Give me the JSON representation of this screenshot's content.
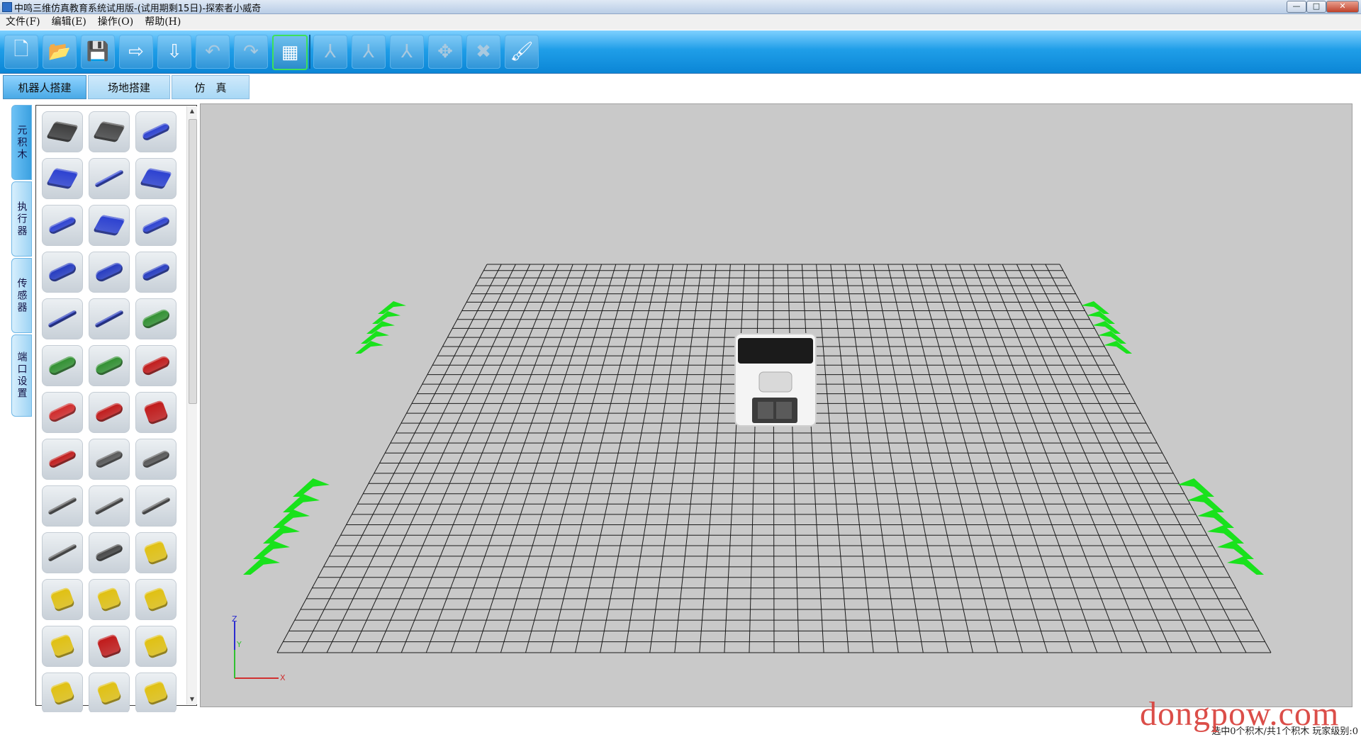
{
  "window": {
    "title": "中鸣三维仿真教育系统试用版-(试用期剩15日)-探索者小威奇",
    "controls": [
      "—",
      "□",
      "✕"
    ]
  },
  "menu": [
    "文件(F)",
    "编辑(E)",
    "操作(O)",
    "帮助(H)"
  ],
  "toolbar": {
    "buttons": [
      {
        "icon": "new-file-icon",
        "glyph": "🗋",
        "state": "normal"
      },
      {
        "icon": "open-folder-icon",
        "glyph": "📂",
        "state": "normal"
      },
      {
        "icon": "save-icon",
        "glyph": "💾",
        "state": "normal"
      },
      {
        "icon": "export-icon",
        "glyph": "⇨",
        "state": "normal"
      },
      {
        "icon": "import-icon",
        "glyph": "⇩",
        "state": "normal"
      },
      {
        "icon": "undo-icon",
        "glyph": "↶",
        "state": "disabled"
      },
      {
        "icon": "redo-icon",
        "glyph": "↷",
        "state": "disabled"
      },
      {
        "icon": "assembly-icon",
        "glyph": "▦",
        "state": "active"
      },
      {
        "icon": "axis-rotate-x-icon",
        "glyph": "⅄",
        "state": "disabled"
      },
      {
        "icon": "axis-rotate-y-icon",
        "glyph": "⅄",
        "state": "disabled"
      },
      {
        "icon": "axis-rotate-z-icon",
        "glyph": "⅄",
        "state": "disabled"
      },
      {
        "icon": "move-icon",
        "glyph": "✥",
        "state": "disabled"
      },
      {
        "icon": "delete-icon",
        "glyph": "✖",
        "state": "disabled"
      },
      {
        "icon": "paint-icon",
        "glyph": "🖌",
        "state": "normal"
      }
    ]
  },
  "tabs": [
    {
      "label": "机器人搭建",
      "active": true
    },
    {
      "label": "场地搭建",
      "active": false
    },
    {
      "label": "仿　真",
      "active": false
    }
  ],
  "side_tabs": [
    {
      "label": "元积木",
      "active": true
    },
    {
      "label": "执行器",
      "active": false
    },
    {
      "label": "传感器",
      "active": false
    },
    {
      "label": "端口设置",
      "active": false
    }
  ],
  "parts": [
    {
      "name": "plate-2x2-dark",
      "color": "#3a3a3a",
      "kind": "plate"
    },
    {
      "name": "plate-2x2-holes-dark",
      "color": "#444444",
      "kind": "plate"
    },
    {
      "name": "beam-blue-short",
      "color": "#2a3fd0",
      "kind": "beam"
    },
    {
      "name": "plate-blue-holes",
      "color": "#2a3fd0",
      "kind": "plate"
    },
    {
      "name": "beam-blue-thin",
      "color": "#2a3fd0",
      "kind": "thin"
    },
    {
      "name": "plate-blue-large",
      "color": "#2a3fd0",
      "kind": "plate"
    },
    {
      "name": "beam-blue-long",
      "color": "#2a3fd0",
      "kind": "beam"
    },
    {
      "name": "plate-blue-long",
      "color": "#2a3fd0",
      "kind": "plate"
    },
    {
      "name": "beam-blue-medium",
      "color": "#2a3fd0",
      "kind": "beam"
    },
    {
      "name": "pin-blue-double",
      "color": "#2339c0",
      "kind": "pin"
    },
    {
      "name": "pin-blue",
      "color": "#2339c0",
      "kind": "pin"
    },
    {
      "name": "axle-blue",
      "color": "#2339c0",
      "kind": "beam"
    },
    {
      "name": "axle-blue-thin",
      "color": "#2034b8",
      "kind": "thin"
    },
    {
      "name": "axle-blue-long",
      "color": "#2034b8",
      "kind": "thin"
    },
    {
      "name": "pin-green",
      "color": "#2f8f2f",
      "kind": "pin"
    },
    {
      "name": "pin-green-large",
      "color": "#2f8f2f",
      "kind": "pin"
    },
    {
      "name": "pin-green-short",
      "color": "#2f8f2f",
      "kind": "pin"
    },
    {
      "name": "pin-red-large",
      "color": "#c01818",
      "kind": "pin"
    },
    {
      "name": "connector-red",
      "color": "#d02828",
      "kind": "pin"
    },
    {
      "name": "pin-red",
      "color": "#c01818",
      "kind": "pin"
    },
    {
      "name": "bush-red",
      "color": "#c01818",
      "kind": "block"
    },
    {
      "name": "axle-red",
      "color": "#c01818",
      "kind": "beam"
    },
    {
      "name": "beam-gray-3",
      "color": "#555555",
      "kind": "beam"
    },
    {
      "name": "beam-gray-5",
      "color": "#555555",
      "kind": "beam"
    },
    {
      "name": "beam-gray-7",
      "color": "#555555",
      "kind": "thin"
    },
    {
      "name": "beam-gray-9",
      "color": "#555555",
      "kind": "thin"
    },
    {
      "name": "beam-gray-11",
      "color": "#555555",
      "kind": "thin"
    },
    {
      "name": "beam-gray-15",
      "color": "#555555",
      "kind": "thin"
    },
    {
      "name": "beam-gray-thick",
      "color": "#444444",
      "kind": "beam"
    },
    {
      "name": "connector-yellow",
      "color": "#e0c010",
      "kind": "block"
    },
    {
      "name": "connector-yellow-cross",
      "color": "#e0c010",
      "kind": "block"
    },
    {
      "name": "connector-yellow-angle",
      "color": "#e0c010",
      "kind": "block"
    },
    {
      "name": "connector-yellow-t",
      "color": "#e0c010",
      "kind": "block"
    },
    {
      "name": "connector-yellow-double",
      "color": "#e0c010",
      "kind": "block"
    },
    {
      "name": "gear-red",
      "color": "#c01818",
      "kind": "block"
    },
    {
      "name": "connector-yellow-hub",
      "color": "#e0c010",
      "kind": "block"
    },
    {
      "name": "connector-yellow-l",
      "color": "#e0c010",
      "kind": "block"
    },
    {
      "name": "connector-yellow-bent",
      "color": "#e0c010",
      "kind": "block"
    },
    {
      "name": "connector-yellow-arm",
      "color": "#e0c010",
      "kind": "block"
    }
  ],
  "viewport": {
    "axis_labels": {
      "z": "Z",
      "y": "Y",
      "x": "X"
    },
    "arrow_color": "#19e21c",
    "grid_color": "#1a1a1a",
    "floor_color": "#c9c9c9"
  },
  "status": {
    "text": "选中0个积木/共1个积木 玩家级别:0"
  },
  "watermark": "dongpow.com"
}
